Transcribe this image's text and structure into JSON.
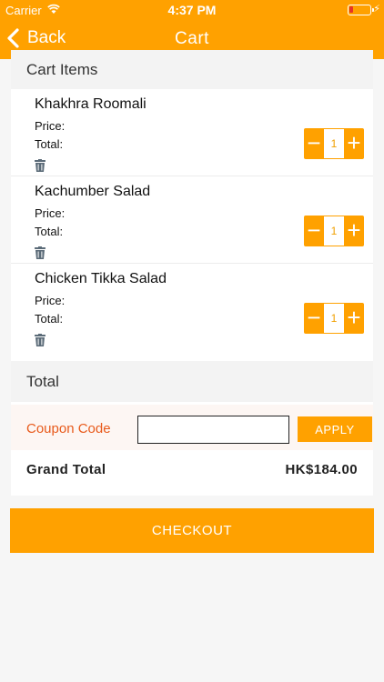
{
  "status_bar": {
    "carrier": "Carrier",
    "time": "4:37 PM"
  },
  "nav": {
    "back_label": "Back",
    "title": "Cart"
  },
  "cart": {
    "section_title": "Cart Items",
    "price_label": "Price:",
    "total_label": "Total:",
    "items": [
      {
        "name": "Khakhra Roomali",
        "quantity": "1"
      },
      {
        "name": "Kachumber Salad",
        "quantity": "1"
      },
      {
        "name": "Chicken Tikka Salad",
        "quantity": "1"
      }
    ]
  },
  "totals": {
    "section_title": "Total",
    "coupon_label": "Coupon Code",
    "coupon_value": "",
    "apply_label": "APPLY",
    "grand_total_label": "Grand Total",
    "grand_total_value": "HK$184.00"
  },
  "checkout_label": "CHECKOUT",
  "icons": {
    "stepper_minus": "minus-icon",
    "stepper_plus": "plus-icon",
    "delete": "trash-icon"
  },
  "colors": {
    "accent": "#ffa100",
    "coupon_label": "#e85a1b",
    "battery_low": "#e6332a"
  }
}
